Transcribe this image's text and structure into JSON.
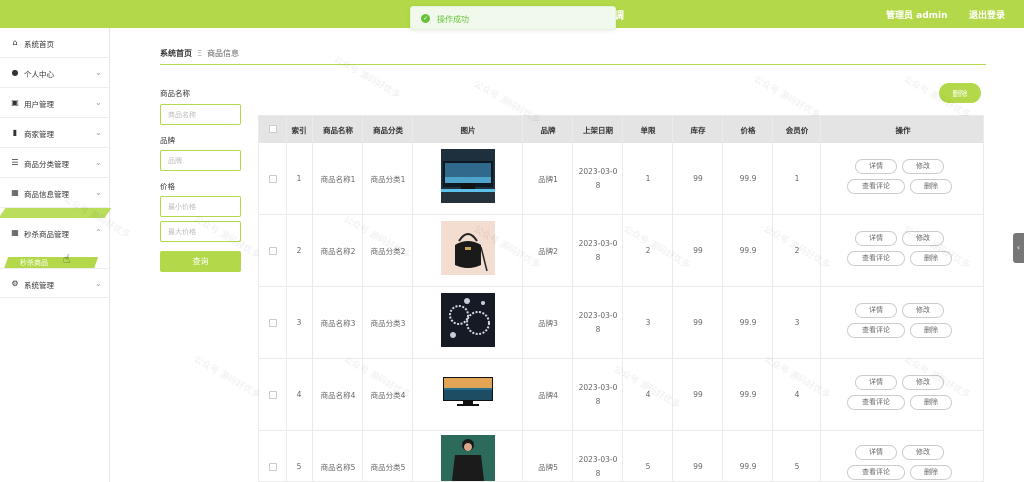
{
  "topbar": {
    "title_fragment": "调",
    "user_label": "管理员 admin",
    "logout_label": "退出登录",
    "accent_color": "#b3d94a"
  },
  "toast": {
    "message": "操作成功",
    "icon": "check-circle-icon"
  },
  "sidebar": {
    "items": [
      {
        "label": "系统首页",
        "icon": "home-icon"
      },
      {
        "label": "个人中心",
        "icon": "user-icon"
      },
      {
        "label": "用户管理",
        "icon": "users-icon"
      },
      {
        "label": "商家管理",
        "icon": "chart-icon"
      },
      {
        "label": "商品分类管理",
        "icon": "list-icon"
      },
      {
        "label": "商品信息管理",
        "icon": "grid-icon"
      },
      {
        "label": "秒杀商品管理",
        "icon": "grid-icon"
      },
      {
        "label": "系统管理",
        "icon": "settings-icon"
      }
    ],
    "sub_item": "秒杀商品"
  },
  "breadcrumb": {
    "home": "系统首页",
    "current": "商品信息"
  },
  "filters": {
    "name_label": "商品名称",
    "name_placeholder": "商品名称",
    "brand_label": "品牌",
    "brand_placeholder": "品牌",
    "price_label": "价格",
    "min_placeholder": "最小价格",
    "max_placeholder": "最大价格",
    "query_label": "查询"
  },
  "delete_label": "删除",
  "table": {
    "headers": [
      "索引",
      "商品名称",
      "商品分类",
      "图片",
      "品牌",
      "上架日期",
      "单限",
      "库存",
      "价格",
      "会员价",
      "操作"
    ],
    "rows": [
      {
        "index": "1",
        "name": "商品名称1",
        "category": "商品分类1",
        "image": "monitor",
        "brand": "品牌1",
        "date1": "2023-03-0",
        "date2": "8",
        "limit": "1",
        "stock": "99",
        "price": "99.9",
        "member": "1"
      },
      {
        "index": "2",
        "name": "商品名称2",
        "category": "商品分类2",
        "image": "bag",
        "brand": "品牌2",
        "date1": "2023-03-0",
        "date2": "8",
        "limit": "2",
        "stock": "99",
        "price": "99.9",
        "member": "2"
      },
      {
        "index": "3",
        "name": "商品名称3",
        "category": "商品分类3",
        "image": "jewelry",
        "brand": "品牌3",
        "date1": "2023-03-0",
        "date2": "8",
        "limit": "3",
        "stock": "99",
        "price": "99.9",
        "member": "3"
      },
      {
        "index": "4",
        "name": "商品名称4",
        "category": "商品分类4",
        "image": "tv",
        "brand": "品牌4",
        "date1": "2023-03-0",
        "date2": "8",
        "limit": "4",
        "stock": "99",
        "price": "99.9",
        "member": "4"
      },
      {
        "index": "5",
        "name": "商品名称5",
        "category": "商品分类5",
        "image": "clothes",
        "brand": "品牌5",
        "date1": "2023-03-0",
        "date2": "8",
        "limit": "5",
        "stock": "99",
        "price": "99.9",
        "member": "5"
      }
    ],
    "actions": {
      "detail": "详情",
      "edit": "修改",
      "review": "查看评论",
      "delete": "删除"
    }
  },
  "watermark": "公众号 源码好优多"
}
